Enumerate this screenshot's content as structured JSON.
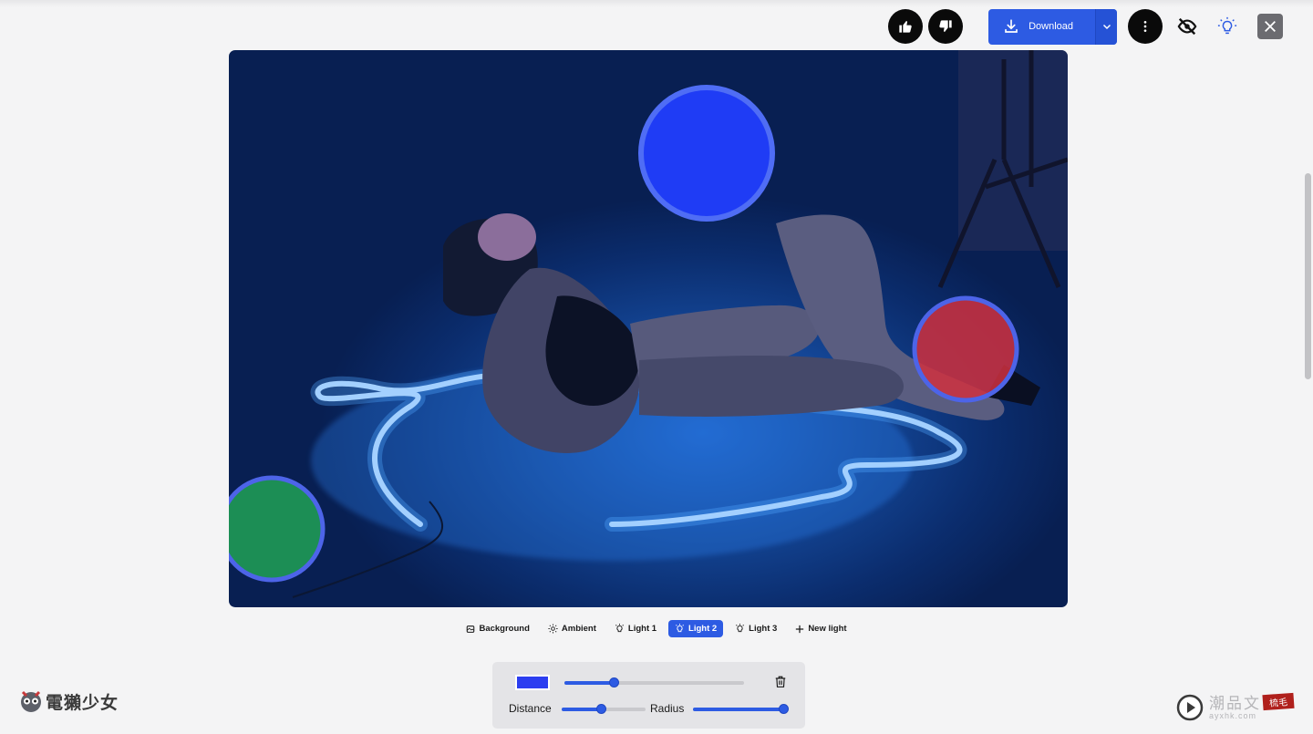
{
  "toolbar": {
    "download_label": "Download",
    "icons": [
      "thumbs-up-icon",
      "thumbs-down-icon",
      "download-icon",
      "chevron-down-icon",
      "more-vertical-icon",
      "eye-off-icon",
      "lightbulb-icon",
      "close-icon"
    ]
  },
  "light_tabs": [
    {
      "label": "Background",
      "icon": "background-icon",
      "active": false
    },
    {
      "label": "Ambient",
      "icon": "sun-icon",
      "active": false
    },
    {
      "label": "Light 1",
      "icon": "bulb-icon",
      "active": false
    },
    {
      "label": "Light 2",
      "icon": "bulb-icon",
      "active": true
    },
    {
      "label": "Light 3",
      "icon": "bulb-icon",
      "active": false
    },
    {
      "label": "New light",
      "icon": "plus-icon",
      "active": false
    }
  ],
  "panel": {
    "color": "#2c3ef0",
    "intensity": 0.28,
    "distance_label": "Distance",
    "distance": 0.48,
    "radius_label": "Radius",
    "radius": 0.98
  },
  "lights": [
    {
      "name": "light-2",
      "color": "#1f3cf5"
    },
    {
      "name": "light-3",
      "color": "#d0303e"
    },
    {
      "name": "light-1",
      "color": "#1f9a55"
    }
  ],
  "watermarks": {
    "left_text": "電獺少女",
    "right_text": "潮品文",
    "right_sub": "ayxhk.com",
    "seal_text": "梳毛"
  },
  "colors": {
    "accent": "#2d5be3"
  }
}
